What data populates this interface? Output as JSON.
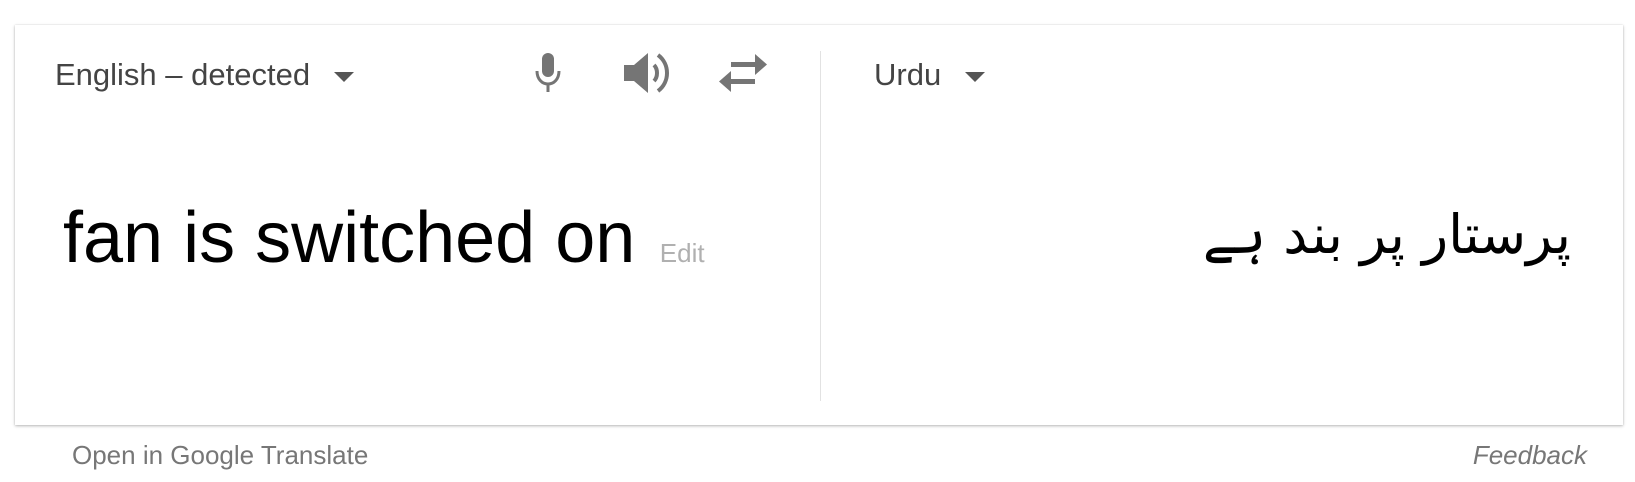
{
  "source": {
    "language_label": "English – detected",
    "text": "fan is switched on",
    "edit_label": "Edit",
    "icons": [
      "microphone-icon",
      "speaker-icon",
      "swap-icon"
    ]
  },
  "target": {
    "language_label": "Urdu",
    "text": "پرستار پر بند ہے"
  },
  "footer": {
    "open_link": "Open in Google Translate",
    "feedback_link": "Feedback"
  },
  "colors": {
    "icon": "#757575",
    "muted_text": "#777777",
    "edit_text": "#b0b0b0",
    "divider": "#e2e2e2"
  }
}
